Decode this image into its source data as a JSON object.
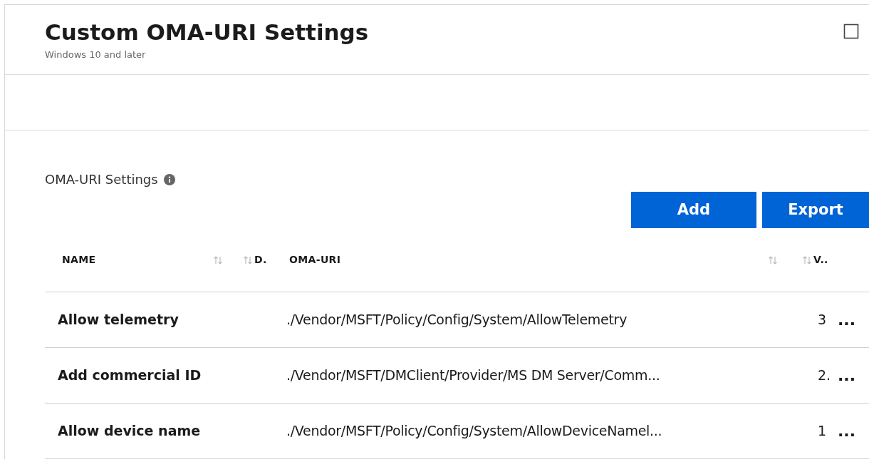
{
  "blade": {
    "title": "Custom OMA-URI Settings",
    "subtitle": "Windows 10 and later"
  },
  "section": {
    "label": "OMA-URI Settings"
  },
  "buttons": [
    {
      "label": "Add"
    },
    {
      "label": "Export"
    }
  ],
  "table": {
    "columns": [
      {
        "label": "NAME",
        "sortable": true
      },
      {
        "label": "D.",
        "sortable": true
      },
      {
        "label": "OMA-URI",
        "sortable": true
      },
      {
        "label": "V..",
        "sortable": true
      }
    ],
    "rows": [
      {
        "name": "Allow telemetry",
        "oma_uri": "./Vendor/MSFT/Policy/Config/System/AllowTelemetry",
        "value": "3",
        "more": "..."
      },
      {
        "name": "Add commercial ID",
        "oma_uri": "./Vendor/MSFT/DMClient/Provider/MS DM Server/Comm...",
        "value": "2.",
        "more": "..."
      },
      {
        "name": "Allow device name",
        "oma_uri": "./Vendor/MSFT/Policy/Config/System/AllowDeviceNamel...",
        "value": "1",
        "more": "..."
      }
    ]
  }
}
